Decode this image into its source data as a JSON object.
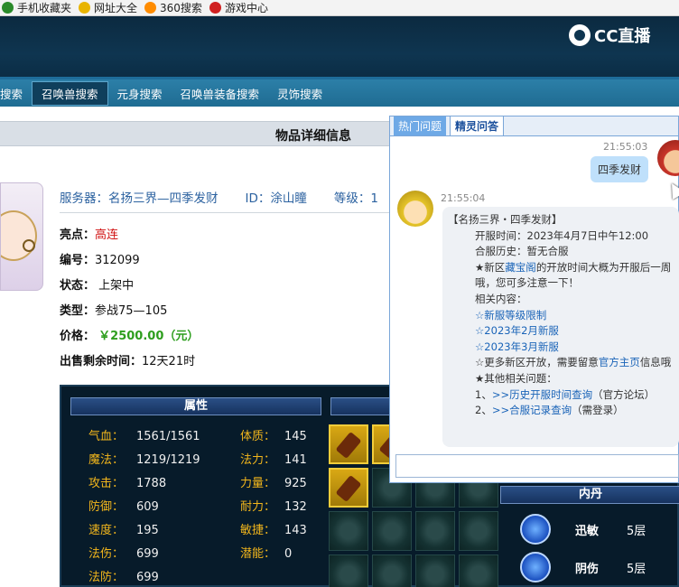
{
  "bookmarks": [
    {
      "label": "手机收藏夹",
      "color": "#2a8a2a"
    },
    {
      "label": "网址大全",
      "color": "#e8b400"
    },
    {
      "label": "360搜索",
      "color": "#ff8c00"
    },
    {
      "label": "游戏中心",
      "color": "#d02020"
    }
  ],
  "header": {
    "logo_text": "CC直播"
  },
  "nav": [
    "搜索",
    "召唤兽搜索",
    "元身搜索",
    "召唤兽装备搜索",
    "灵饰搜索"
  ],
  "page": {
    "title": "物品详细信息",
    "server_label": "服务器：",
    "server_value": "名扬三界—四季发财",
    "id_label": "ID：",
    "id_value": "涂山瞳",
    "level_label": "等级：",
    "level_value": "1"
  },
  "info": {
    "highlight_label": "亮点：",
    "highlight_value": "高连",
    "number_label": "编号：",
    "number_value": "312099",
    "status_label": "状态：",
    "status_value": "上架中",
    "type_label": "类型：",
    "type_value": "参战75—105",
    "price_label": "价格：",
    "price_value": "￥2500.00（元）",
    "remain_label": "出售剩余时间：",
    "remain_value": "12天21时"
  },
  "attributes": {
    "heading": "属性",
    "left": [
      {
        "k": "气血：",
        "v": "1561/1561"
      },
      {
        "k": "魔法：",
        "v": "1219/1219"
      },
      {
        "k": "攻击：",
        "v": "1788"
      },
      {
        "k": "防御：",
        "v": "609"
      },
      {
        "k": "速度：",
        "v": "195"
      },
      {
        "k": "法伤：",
        "v": "699"
      },
      {
        "k": "法防：",
        "v": "699"
      }
    ],
    "right": [
      {
        "k": "体质：",
        "v": "145"
      },
      {
        "k": "法力：",
        "v": "141"
      },
      {
        "k": "力量：",
        "v": "925"
      },
      {
        "k": "耐力：",
        "v": "132"
      },
      {
        "k": "敏捷：",
        "v": "143"
      },
      {
        "k": "潜能：",
        "v": "0"
      }
    ]
  },
  "neidan": {
    "heading": "内丹",
    "items": [
      {
        "name": "迅敏",
        "level": "5层"
      },
      {
        "name": "阴伤",
        "level": "5层"
      }
    ]
  },
  "chat": {
    "tab_hot": "热门问题",
    "tab_active": "精灵问答",
    "time_user": "21:55:03",
    "user_msg": "四季发财",
    "time_bot": "21:55:04",
    "bot_lines": [
      "【名扬三界・四季发财】",
      "开服时间：2023年4月7日中午12:00",
      "合服历史：暂无合服"
    ],
    "notice_prefix": "★新区",
    "notice_link": "藏宝阁",
    "notice_suffix": "的开放时间大概为开服后一周哦，您可多注意一下！",
    "related_label": "相关内容：",
    "links": [
      "☆新服等级限制",
      "☆2023年2月新服",
      "☆2023年3月新服"
    ],
    "more_prefix": "☆更多新区开放，需要留意",
    "more_link": "官方主页",
    "more_suffix": "信息哦",
    "other_label": "★其他相关问题：",
    "q1_prefix": "1、",
    "q1_link": ">>历史开服时间查询",
    "q1_suffix": "（官方论坛）",
    "q2_prefix": "2、",
    "q2_link": ">>合服记录查询",
    "q2_suffix": "（需登录）"
  }
}
